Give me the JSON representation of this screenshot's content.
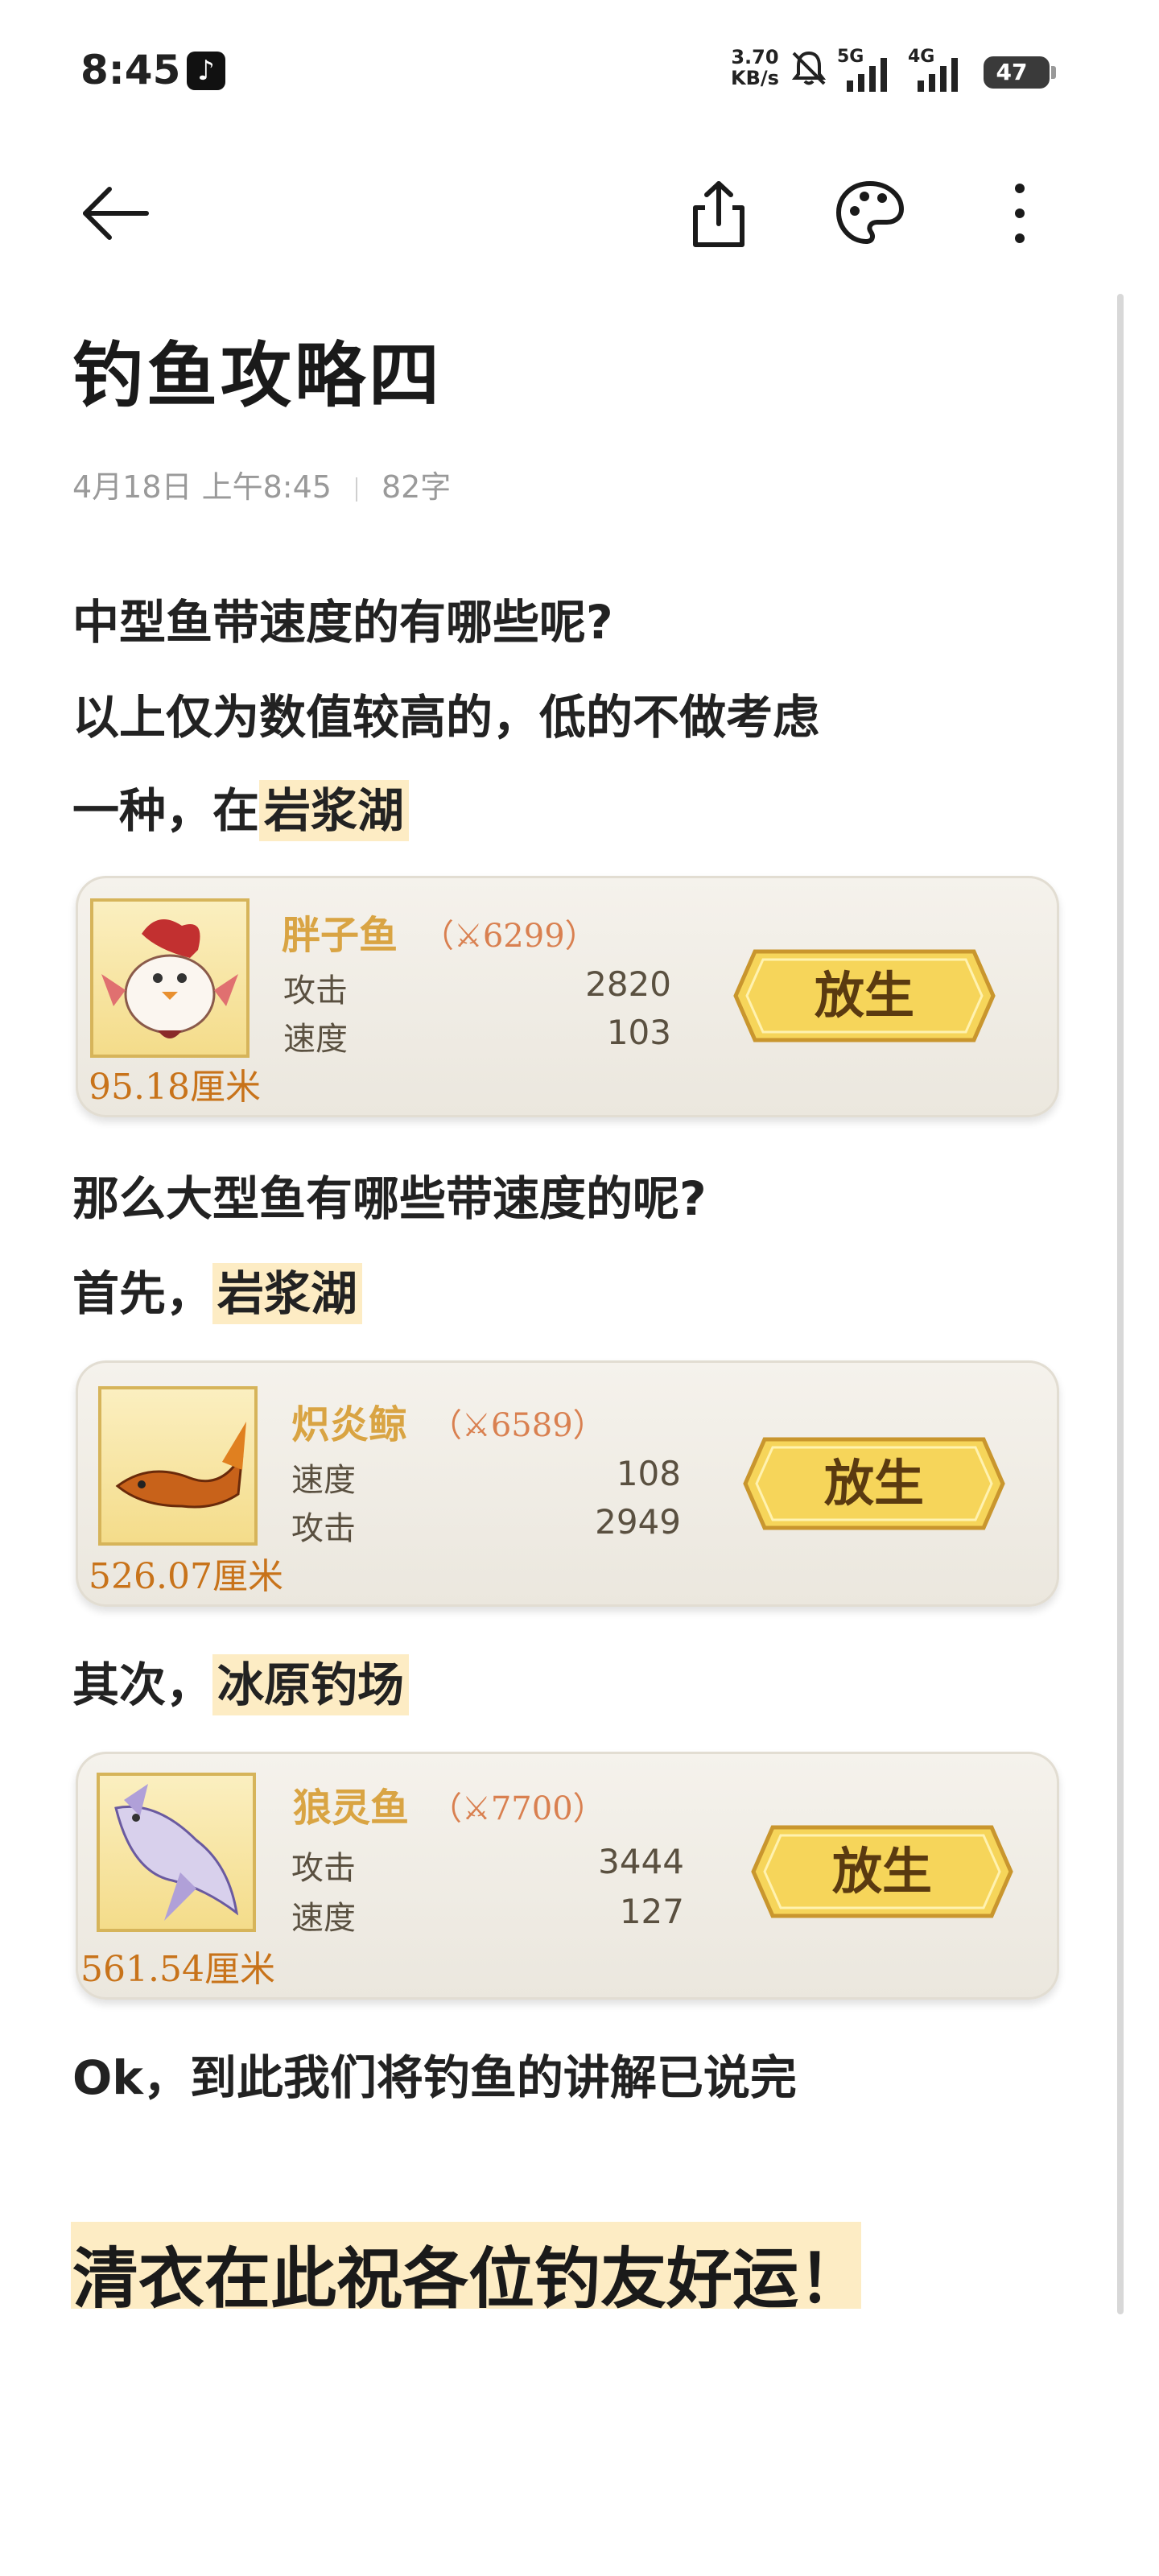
{
  "status_bar": {
    "time": "8:45",
    "net_speed_value": "3.70",
    "net_speed_unit": "KB/s",
    "sim1": "5G",
    "sim2": "4G",
    "battery": "47"
  },
  "toolbar": {
    "back_icon": "arrow-left-icon",
    "share_icon": "share-icon",
    "palette_icon": "palette-icon",
    "more_icon": "more-vertical-icon"
  },
  "note": {
    "title": "钓鱼攻略四",
    "date": "4月18日 上午8:45",
    "word_count": "82字",
    "p1": "中型鱼带速度的有哪些呢?",
    "p2": "以上仅为数值较高的，低的不做考虑",
    "p3_prefix": "一种，在",
    "p3_hl": "岩浆湖",
    "p4": "那么大型鱼有哪些带速度的呢?",
    "p5_prefix": "首先，",
    "p5_hl": "岩浆湖",
    "p6_prefix": "其次，",
    "p6_hl": "冰原钓场",
    "p7": "Ok，到此我们将钓鱼的讲解已说完",
    "closing": "清衣在此祝各位钓友好运！"
  },
  "cards": [
    {
      "name": "胖子鱼",
      "power": "6299",
      "size": "95.18厘米",
      "stat1_label": "攻击",
      "stat1_value": "2820",
      "stat2_label": "速度",
      "stat2_value": "103",
      "button": "放生"
    },
    {
      "name": "炽炎鲸",
      "power": "6589",
      "size": "526.07厘米",
      "stat1_label": "速度",
      "stat1_value": "108",
      "stat2_label": "攻击",
      "stat2_value": "2949",
      "button": "放生"
    },
    {
      "name": "狼灵鱼",
      "power": "7700",
      "size": "561.54厘米",
      "stat1_label": "攻击",
      "stat1_value": "3444",
      "stat2_label": "速度",
      "stat2_value": "127",
      "button": "放生"
    }
  ],
  "colors": {
    "highlight": "#fdecc4",
    "fish_name": "#d9a443",
    "size_label": "#c8731a"
  }
}
